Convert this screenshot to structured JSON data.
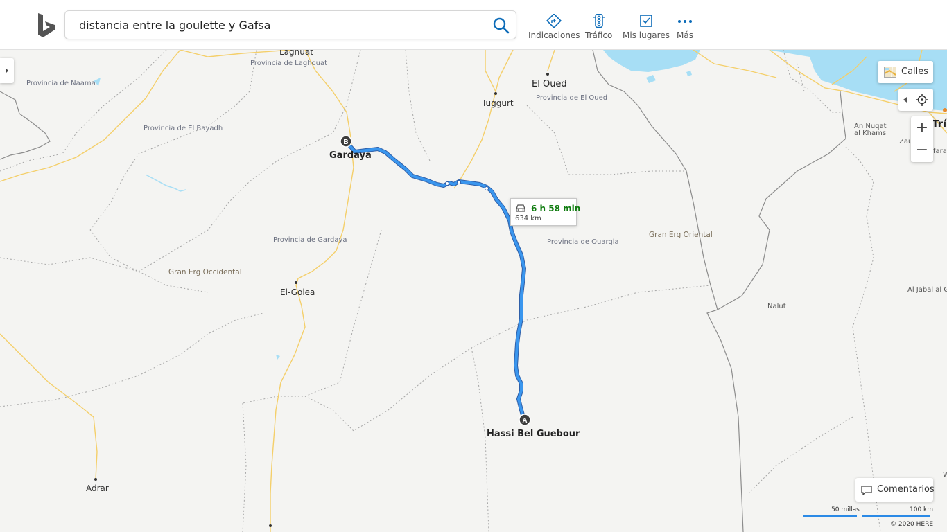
{
  "search": {
    "query": "distancia entre la goulette y Gafsa"
  },
  "nav": [
    {
      "label": "Indicaciones",
      "icon": "directions-icon"
    },
    {
      "label": "Tráfico",
      "icon": "traffic-light-icon"
    },
    {
      "label": "Mis lugares",
      "icon": "my-places-icon"
    },
    {
      "label": "Más",
      "icon": "more-icon"
    }
  ],
  "map": {
    "regions": {
      "naama": "Provincia de Naama",
      "laghouat": "Provincia de Laghouat",
      "el_bayadh": "Provincia de El Bayadh",
      "gardaya": "Provincia de Gardaya",
      "ouargla": "Provincia de Ouargla",
      "el_oued": "Provincia de El Oued"
    },
    "deserts": {
      "occidental": "Gran Erg Occidental",
      "oriental": "Gran Erg Oriental"
    },
    "cities": {
      "lagnuat": "Lagnuat",
      "el_oued": "El Oued",
      "tuggurt": "Tuggurt",
      "gardaya": "Gardaya",
      "el_golea": "El-Golea",
      "hassi": "Hassi Bel Guebour",
      "adrar": "Adrar",
      "nalut": "Nalut",
      "an_nuqat_1": "An Nuqat",
      "an_nuqat_2": "al Khams",
      "trip": "Tríp",
      "zau": "Zau",
      "fara": "fara",
      "jabal": "Al Jabal al G",
      "w": "W"
    },
    "markers": {
      "start": "A",
      "end": "B"
    }
  },
  "route": {
    "time": "6 h 58 min",
    "distance": "634 km"
  },
  "controls": {
    "calles_label": "Calles",
    "zoom_in": "+",
    "zoom_out": "−",
    "comentarios_label": "Comentarios"
  },
  "scale": {
    "miles": "50 millas",
    "km": "100 km"
  },
  "copyright": "© 2020 HERE",
  "colors": {
    "route": "#2b8ae6",
    "water": "#a7def5",
    "road": "#f7d37a",
    "accent": "#0072c6"
  }
}
